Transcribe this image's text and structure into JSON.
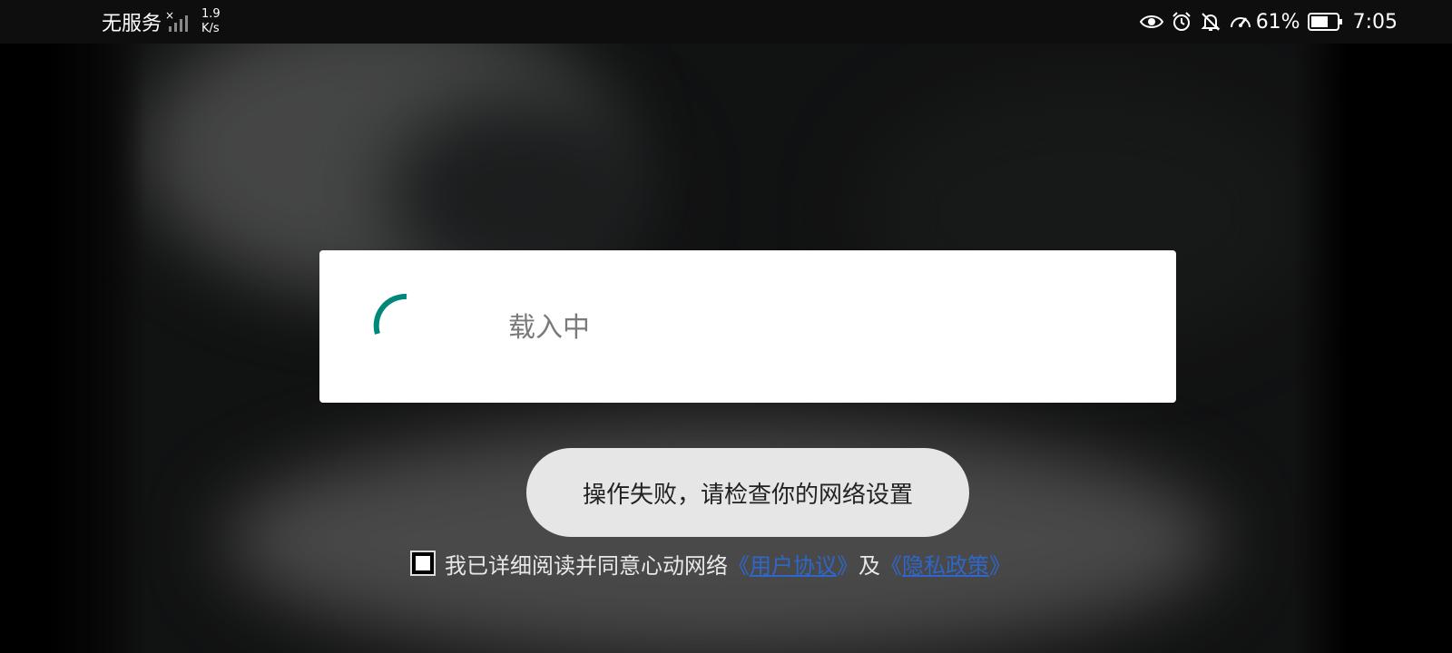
{
  "status_bar": {
    "carrier": "无服务",
    "net_speed_value": "1.9",
    "net_speed_unit": "K/s",
    "battery_percent": "61%",
    "time": "7:05",
    "icons": [
      "no-signal-icon",
      "eye-icon",
      "alarm-icon",
      "bell-off-icon",
      "speedometer-icon",
      "battery-icon"
    ]
  },
  "dialog": {
    "loading_text": "载入中",
    "spinner_color": "#00897b"
  },
  "toast": {
    "message": "操作失败，请检查你的网络设置"
  },
  "agreement": {
    "checked": true,
    "prefix": "我已详细阅读并同意心动网络",
    "open_bracket_1": "《",
    "user_agreement": "用户协议",
    "close_bracket_1": "》",
    "conjunction": "及",
    "open_bracket_2": "《",
    "privacy_policy": "隐私政策",
    "close_bracket_2": "》",
    "link_color": "#2f66c9"
  }
}
